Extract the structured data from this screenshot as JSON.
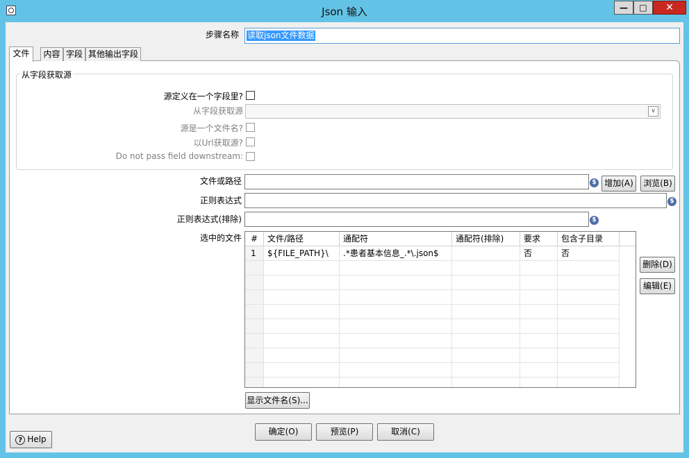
{
  "window": {
    "title": "Json 输入",
    "minimize_label": "—",
    "maximize_label": "□",
    "close_label": "✕"
  },
  "step_name": {
    "label": "步骤名称",
    "value": "读取json文件数据"
  },
  "tabs": [
    {
      "label": "文件",
      "active": true
    },
    {
      "label": "内容",
      "active": false
    },
    {
      "label": "字段",
      "active": false
    },
    {
      "label": "其他输出字段",
      "active": false
    }
  ],
  "source_group": {
    "title": "从字段获取源",
    "source_in_field_label": "源定义在一个字段里?",
    "source_in_field_checked": false,
    "get_source_from_field_label": "从字段获取源",
    "get_source_from_field_value": "",
    "source_is_filename_label": "源是一个文件名?",
    "source_from_url_label": "以Url获取源?",
    "do_not_pass_label": "Do not pass field downstream:"
  },
  "file_form": {
    "file_or_path_label": "文件或路径",
    "file_or_path_value": "",
    "regex_label": "正则表达式",
    "regex_value": "",
    "regex_exclude_label": "正则表达式(排除)",
    "regex_exclude_value": "",
    "selected_files_label": "选中的文件",
    "add_button": "增加(A)",
    "browse_button": "浏览(B)",
    "delete_button": "删除(D)",
    "edit_button": "编辑(E)",
    "show_filenames_button": "显示文件名(S)..."
  },
  "files_table": {
    "columns": [
      "#",
      "文件/路径",
      "通配符",
      "通配符(排除)",
      "要求",
      "包含子目录"
    ],
    "rows": [
      [
        "1",
        "${FILE_PATH}\\",
        ".*患者基本信息_.*\\.json$",
        "",
        "否",
        "否"
      ]
    ]
  },
  "footer": {
    "ok_button": "确定(O)",
    "preview_button": "预览(P)",
    "cancel_button": "取消(C)",
    "help_button": "Help",
    "help_icon_glyph": "?"
  },
  "icons": {
    "variable_icon_glyph": "$",
    "combo_arrow_glyph": "∨"
  },
  "colors": {
    "titlebar": "#63c3e6",
    "close_button": "#c8281f",
    "selection": "#3399ff"
  }
}
